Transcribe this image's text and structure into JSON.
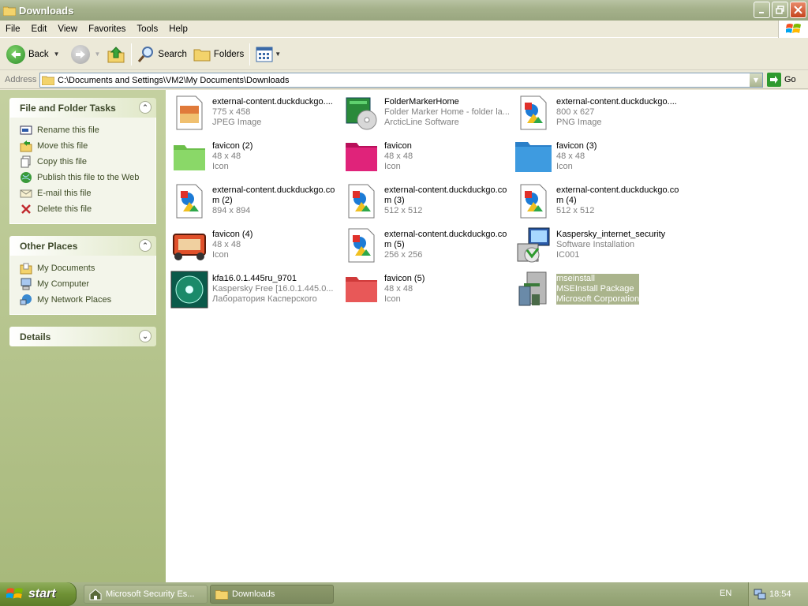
{
  "window": {
    "title": "Downloads",
    "controls": [
      "minimize",
      "maximize",
      "close"
    ]
  },
  "menu": [
    "File",
    "Edit",
    "View",
    "Favorites",
    "Tools",
    "Help"
  ],
  "toolbar": {
    "back_label": "Back",
    "search_label": "Search",
    "folders_label": "Folders"
  },
  "address": {
    "label": "Address",
    "value": "C:\\Documents and Settings\\VM2\\My Documents\\Downloads",
    "go_label": "Go"
  },
  "left_pane": {
    "file_tasks": {
      "title": "File and Folder Tasks",
      "items": [
        {
          "label": "Rename this file",
          "icon": "rename-icon"
        },
        {
          "label": "Move this file",
          "icon": "move-icon"
        },
        {
          "label": "Copy this file",
          "icon": "copy-icon"
        },
        {
          "label": "Publish this file to the Web",
          "icon": "globe-icon"
        },
        {
          "label": "E-mail this file",
          "icon": "email-icon"
        },
        {
          "label": "Delete this file",
          "icon": "delete-icon"
        }
      ]
    },
    "other_places": {
      "title": "Other Places",
      "items": [
        {
          "label": "My Documents",
          "icon": "my-documents-icon"
        },
        {
          "label": "My Computer",
          "icon": "my-computer-icon"
        },
        {
          "label": "My Network Places",
          "icon": "network-places-icon"
        }
      ]
    },
    "details": {
      "title": "Details"
    }
  },
  "files": [
    {
      "name": "external-content.duckduckgo....",
      "line2": "775 x 458",
      "line3": "JPEG Image",
      "icon": "jpeg-image-icon"
    },
    {
      "name": "FolderMarkerHome",
      "line2": "Folder Marker Home - folder la...",
      "line3": "ArcticLine Software",
      "icon": "foldermarker-installer-icon"
    },
    {
      "name": "external-content.duckduckgo....",
      "line2": "800 x 627",
      "line3": "PNG Image",
      "icon": "png-image-icon"
    },
    {
      "name": "favicon (2)",
      "line2": "48 x 48",
      "line3": "Icon",
      "icon": "green-folder-icon"
    },
    {
      "name": "favicon",
      "line2": "48 x 48",
      "line3": "Icon",
      "icon": "pink-folder-icon"
    },
    {
      "name": "favicon (3)",
      "line2": "48 x 48",
      "line3": "Icon",
      "icon": "blue-folder-icon"
    },
    {
      "name": "external-content.duckduckgo.co",
      "line2": "m (2)",
      "line3": "894 x 894",
      "icon": "image-file-icon"
    },
    {
      "name": "external-content.duckduckgo.co",
      "line2": "m (3)",
      "line3": "512 x 512",
      "icon": "image-file-icon"
    },
    {
      "name": "external-content.duckduckgo.co",
      "line2": "m (4)",
      "line3": "512 x 512",
      "icon": "image-file-icon"
    },
    {
      "name": "favicon (4)",
      "line2": "48 x 48",
      "line3": "Icon",
      "icon": "generator-icon"
    },
    {
      "name": "external-content.duckduckgo.co",
      "line2": "m (5)",
      "line3": "256 x 256",
      "icon": "image-file-icon"
    },
    {
      "name": "Kaspersky_internet_security",
      "line2": "Software Installation",
      "line3": "IC001",
      "icon": "installer-package-icon"
    },
    {
      "name": "kfa16.0.1.445ru_9701",
      "line2": "Kaspersky Free [16.0.1.445.0...",
      "line3": "Лаборатория Касперского",
      "icon": "kaspersky-disc-icon"
    },
    {
      "name": "favicon (5)",
      "line2": "48 x 48",
      "line3": "Icon",
      "icon": "red-folder-icon"
    },
    {
      "name": "mseinstall",
      "line2": "MSEInstall Package",
      "line3": "Microsoft Corporation",
      "icon": "mse-install-icon",
      "selected": true
    }
  ],
  "taskbar": {
    "start_label": "start",
    "items": [
      {
        "label": "Microsoft Security Es...",
        "icon": "mse-house-icon",
        "active": false
      },
      {
        "label": "Downloads",
        "icon": "folder-icon",
        "active": true
      }
    ],
    "language": "EN",
    "clock": "18:54"
  },
  "colors": {
    "theme_olive": "#a6b28c",
    "left_pane_top": "#c4d0a0",
    "task_link": "#3d4b25",
    "selection": "#aab48c"
  }
}
